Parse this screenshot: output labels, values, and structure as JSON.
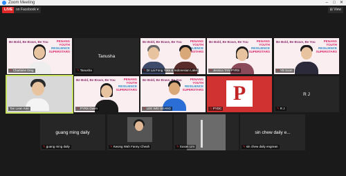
{
  "window": {
    "title": "Zoom Meeting"
  },
  "live": {
    "badge": "LIVE",
    "target": "on Facebook ▾"
  },
  "banner": {
    "line1": "Be Bold, Be Brave, Be You",
    "b2a": "PENANG",
    "b2b": "YOUTH",
    "b2c": "RESILIENCE",
    "b2d": "SUPERSTARS"
  },
  "tiles": [
    {
      "name": "Charlaine Ding"
    },
    {
      "name": "Tanusha",
      "center": "Tanusha"
    },
    {
      "name": "Dr Lai Fong Yoke & Indonesian Lake"
    },
    {
      "name": "Jessica TAN PYRS"
    },
    {
      "name": "YB Soon"
    },
    {
      "name": "Tan Lean Kee"
    },
    {
      "name": "PYRS Gwen"
    },
    {
      "name": "LEE WEI SEANG"
    },
    {
      "name": "PYDC"
    },
    {
      "name": "R J",
      "center": "R J"
    },
    {
      "name": "guang ming daily",
      "center": "guang ming daily"
    },
    {
      "name": "Kwong Wah Fanny Cheah"
    },
    {
      "name": "Susan Lim"
    },
    {
      "name": "sin chew daily engrean",
      "center": "sin chew daily e..."
    }
  ],
  "colors": {
    "live": "#e02828",
    "active_outline": "#c7e25f",
    "banner_bg": "#fbeef0"
  }
}
